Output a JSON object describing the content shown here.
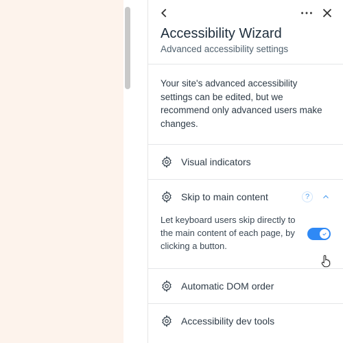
{
  "panel": {
    "title": "Accessibility Wizard",
    "subtitle": "Advanced accessibility settings",
    "intro": "Your site's advanced accessibility settings can be edited, but we recommend only advanced users make changes."
  },
  "sections": {
    "visual_indicators": {
      "label": "Visual indicators"
    },
    "skip_main": {
      "label": "Skip to main content",
      "description": "Let keyboard users skip directly to the main content of each page, by clicking a button.",
      "toggle_on": true
    },
    "dom_order": {
      "label": "Automatic DOM order"
    },
    "dev_tools": {
      "label": "Accessibility dev tools"
    }
  },
  "icons": {
    "back": "chevron-left",
    "more": "more-horizontal",
    "close": "x",
    "gear": "settings-gear",
    "help": "?",
    "chev_up": "chevron-up"
  }
}
